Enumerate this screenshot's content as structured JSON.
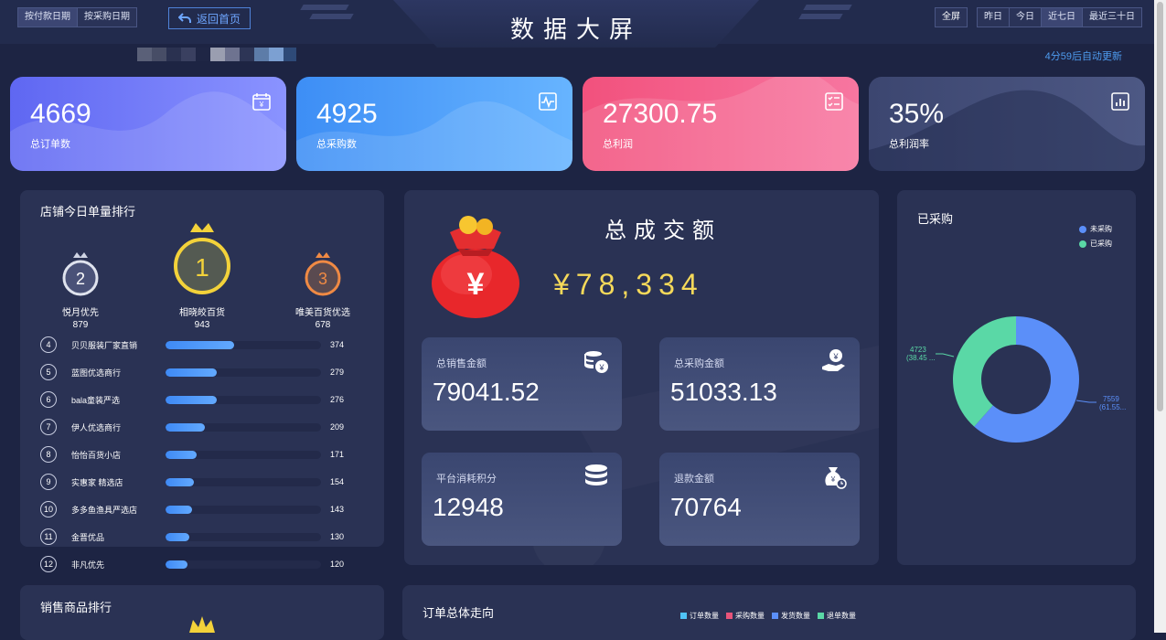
{
  "header": {
    "title": "数据大屏",
    "date_mode_tabs": [
      "按付款日期",
      "按采购日期"
    ],
    "home_button": "返回首页",
    "fullscreen": "全屏",
    "range_tabs": [
      "昨日",
      "今日",
      "近七日",
      "最近三十日"
    ],
    "active_range": "近七日",
    "countdown": "4分59后自动更新"
  },
  "stats": [
    {
      "value": "4669",
      "label": "总订单数",
      "icon": "calendar-yen-icon"
    },
    {
      "value": "4925",
      "label": "总采购数",
      "icon": "pulse-chart-icon"
    },
    {
      "value": "27300.75",
      "label": "总利润",
      "icon": "checklist-icon"
    },
    {
      "value": "35%",
      "label": "总利润率",
      "icon": "bar-chart-icon"
    }
  ],
  "shop_ranking": {
    "title": "店铺今日单量排行",
    "podium": [
      {
        "rank": "2",
        "name": "悦月优先",
        "value": "879"
      },
      {
        "rank": "1",
        "name": "相晓皎百货",
        "value": "943"
      },
      {
        "rank": "3",
        "name": "唯美百货优选",
        "value": "678"
      }
    ],
    "rows": [
      {
        "rank": "4",
        "name": "贝贝服装厂家直销",
        "value": "374",
        "ratio": 0.44
      },
      {
        "rank": "5",
        "name": "蓝图优选商行",
        "value": "279",
        "ratio": 0.33
      },
      {
        "rank": "6",
        "name": "bala童装严选",
        "value": "276",
        "ratio": 0.33
      },
      {
        "rank": "7",
        "name": "伊人优选商行",
        "value": "209",
        "ratio": 0.25
      },
      {
        "rank": "8",
        "name": "怡怡百货小店",
        "value": "171",
        "ratio": 0.2
      },
      {
        "rank": "9",
        "name": "实惠家 精选店",
        "value": "154",
        "ratio": 0.18
      },
      {
        "rank": "10",
        "name": "多多鱼渔具严选店",
        "value": "143",
        "ratio": 0.17
      },
      {
        "rank": "11",
        "name": "金晋优品",
        "value": "130",
        "ratio": 0.15
      },
      {
        "rank": "12",
        "name": "非凡优先",
        "value": "120",
        "ratio": 0.14
      }
    ]
  },
  "turnover": {
    "title": "总成交额",
    "amount": "¥78,334",
    "cards": [
      {
        "label": "总销售金额",
        "value": "79041.52",
        "icon": "coins-yen-icon"
      },
      {
        "label": "总采购金额",
        "value": "51033.13",
        "icon": "hand-coin-icon"
      },
      {
        "label": "平台消耗积分",
        "value": "12948",
        "icon": "database-icon"
      },
      {
        "label": "退款金额",
        "value": "70764",
        "icon": "money-bag-clock-icon"
      }
    ]
  },
  "purchase": {
    "title": "已采购",
    "legend": [
      {
        "name": "未采购",
        "color": "#5b8ff9"
      },
      {
        "name": "已采购",
        "color": "#5ad8a6"
      }
    ],
    "label_purchased": "4723",
    "label_purchased_pct": "(38.45 ...",
    "label_unpurchased": "7559",
    "label_unpurchased_pct": "(61.55...",
    "colors": {
      "unpurchased": "#5b8ff9",
      "purchased": "#5ad8a6"
    }
  },
  "chart_data": {
    "type": "pie",
    "labels": [
      "未采购",
      "已采购"
    ],
    "values": [
      7559,
      4723
    ],
    "title": "已采购"
  },
  "bottom": {
    "left_title": "销售商品排行",
    "right_title": "订单总体走向",
    "legend": [
      {
        "name": "订单数量",
        "color": "#4fc3f7"
      },
      {
        "name": "采购数量",
        "color": "#e8547a"
      },
      {
        "name": "发货数量",
        "color": "#5b8ff9"
      },
      {
        "name": "退单数量",
        "color": "#5ad8a6"
      }
    ]
  }
}
